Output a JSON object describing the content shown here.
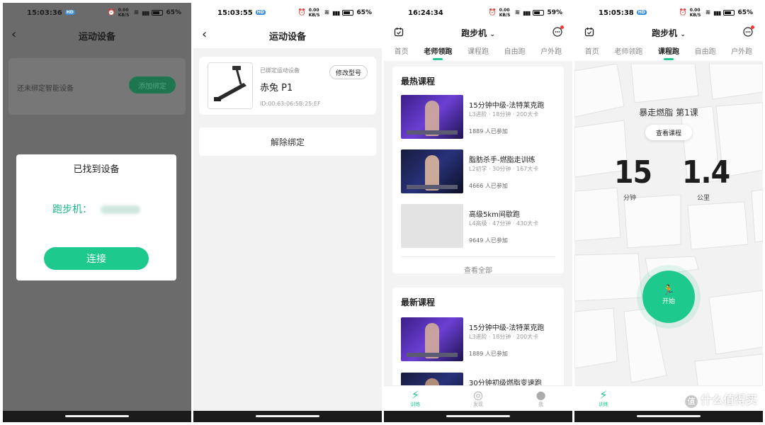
{
  "screens": {
    "s1": {
      "status": {
        "time": "15:03:36",
        "chip": "HD",
        "net": "0.00 KB/S",
        "battery": "65%"
      },
      "nav_title": "运动设备",
      "card_text": "还未绑定智能设备",
      "add_button": "添加绑定",
      "dialog": {
        "title": "已找到设备",
        "device_label": "跑步机：",
        "connect": "连接"
      }
    },
    "s2": {
      "status": {
        "time": "15:03:55",
        "chip": "HD",
        "net": "0.00 KB/S",
        "battery": "65%"
      },
      "nav_title": "运动设备",
      "bound_label": "已绑定运动设备",
      "device_name": "赤兔 P1",
      "device_id": "ID:00:63:06:5B:25:EF",
      "change_model": "修改型号",
      "unbind": "解除绑定"
    },
    "s3": {
      "status": {
        "time": "16:24:34",
        "net": "0.00 KB/S",
        "battery": "59%"
      },
      "title": "跑步机",
      "tabs": [
        "首页",
        "老师领跑",
        "课程跑",
        "自由跑",
        "户外跑"
      ],
      "active_tab": 1,
      "hot": {
        "header": "最热课程",
        "courses": [
          {
            "title": "15分钟中级-法特莱克跑",
            "sub": "L3进阶 · 18分钟 · 200大卡",
            "count": "1889 人已参加"
          },
          {
            "title": "脂肪杀手-燃脂走训练",
            "sub": "L2初学 · 30分钟 · 167大卡",
            "count": "4666 人已参加"
          },
          {
            "title": "高级5km间歇跑",
            "sub": "L4高级 · 47分钟 · 430大卡",
            "count": "9649 人已参加"
          }
        ],
        "view_all": "查看全部"
      },
      "new": {
        "header": "最新课程",
        "courses": [
          {
            "title": "15分钟中级-法特莱克跑",
            "sub": "L3进阶 · 18分钟 · 200大卡",
            "count": "1889 人已参加"
          },
          {
            "title": "30分钟初级燃脂变速跑"
          }
        ]
      },
      "tabbar": [
        "训练",
        "发现",
        "我"
      ]
    },
    "s4": {
      "status": {
        "time": "15:05:38",
        "chip": "HD",
        "net": "0.00 KB/S",
        "battery": "65%"
      },
      "title": "跑步机",
      "tabs": [
        "首页",
        "老师领跑",
        "课程跑",
        "自由跑",
        "户外跑"
      ],
      "active_tab": 2,
      "lesson": "暴走燃脂 第1课",
      "view_course": "查看课程",
      "minutes": "15",
      "minutes_unit": "分钟",
      "km": "1.4",
      "km_unit": "公里",
      "start": "开始",
      "tabbar": [
        "训练"
      ],
      "watermark": "什么值得买",
      "watermark_badge": "值"
    }
  },
  "colors": {
    "accent": "#1ec98e",
    "dim_overlay": "#6b6b6b"
  },
  "icons": {
    "back": "chevron-left-icon",
    "calendar": "calendar-icon",
    "more": "chat-more-icon",
    "train": "lightning-icon",
    "discover": "compass-icon",
    "me": "person-icon",
    "run": "runner-icon"
  }
}
